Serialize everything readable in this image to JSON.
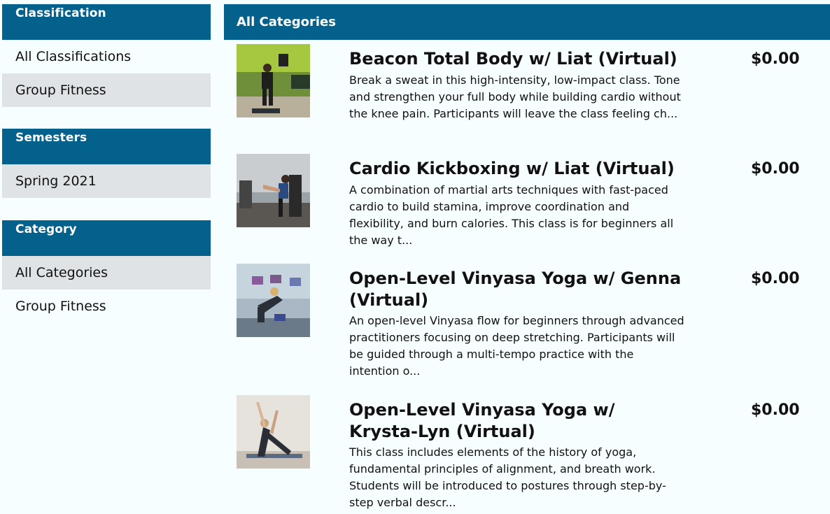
{
  "sidebar": {
    "classification": {
      "header": "Classification",
      "items": [
        "All Classifications",
        "Group Fitness"
      ]
    },
    "semesters": {
      "header": "Semesters",
      "items": [
        "Spring 2021"
      ]
    },
    "category": {
      "header": "Category",
      "items": [
        "All Categories",
        "Group Fitness"
      ]
    }
  },
  "main": {
    "header": "All Categories",
    "courses": [
      {
        "title": "Beacon Total Body w/ Liat (Virtual)",
        "price": "$0.00",
        "description": "Break a sweat in this high-intensity, low-impact class. Tone and strengthen your full body while building cardio without the knee pain. Participants will leave the class feeling ch..."
      },
      {
        "title": "Cardio Kickboxing w/ Liat (Virtual)",
        "price": "$0.00",
        "description": "A combination of martial arts techniques with fast-paced cardio to build stamina, improve coordination and flexibility, and burn calories. This class is for beginners all the way t..."
      },
      {
        "title": "Open-Level Vinyasa Yoga w/ Genna (Virtual)",
        "price": "$0.00",
        "description": "An open-level Vinyasa flow for beginners through advanced practitioners focusing on deep stretching. Participants will be guided through a multi-tempo practice with the intention o..."
      },
      {
        "title": "Open-Level Vinyasa Yoga w/ Krysta-Lyn (Virtual)",
        "price": "$0.00",
        "description": "This class includes elements of the history of yoga, fundamental principles of alignment, and breath work. Students will be introduced to postures through step-by-step verbal descr..."
      }
    ]
  },
  "colors": {
    "header_bg": "#03618b",
    "active_item_bg": "#dfe3e6",
    "page_bg": "#f7feff"
  }
}
